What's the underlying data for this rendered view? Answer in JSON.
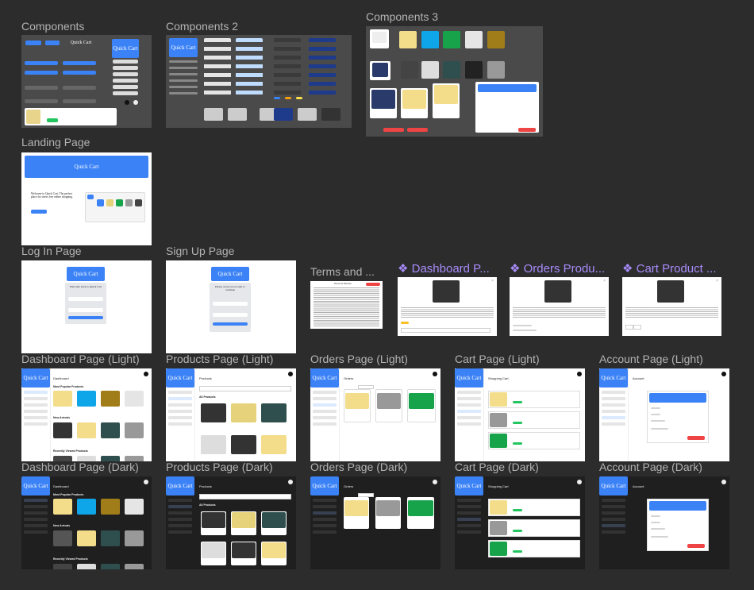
{
  "labels": {
    "components": "Components",
    "components2": "Components 2",
    "components3": "Components 3",
    "landing": "Landing Page",
    "login": "Log In Page",
    "signup": "Sign Up Page",
    "terms": "Terms and ...",
    "dash_popup": "❖ Dashboard P...",
    "orders_popup": "❖ Orders Produ...",
    "cart_popup": "❖ Cart Product ...",
    "dash_light": "Dashboard Page (Light)",
    "products_light": "Products Page (Light)",
    "orders_light": "Orders Page (Light)",
    "cart_light": "Cart Page (Light)",
    "account_light": "Account Page (Light)",
    "dash_dark": "Dashboard Page (Dark)",
    "products_dark": "Products Page (Dark)",
    "orders_dark": "Orders Page (Dark)",
    "cart_dark": "Cart Page (Dark)",
    "account_dark": "Account Page (Dark)"
  },
  "brand": "Quick Cart",
  "frames": {
    "landing_tagline": "Welcome to Quick Cart. The perfect place for stress free online shopping.",
    "login_heading": "Welcome back to Quick Cart",
    "signup_heading": "Please create an account to continue",
    "dash_title": "Dashboard",
    "dash_most_popular": "Most Popular Products",
    "dash_new_arrivals": "New Arrivals",
    "dash_recently_viewed": "Recently Viewed Products",
    "products_title": "Products",
    "products_all": "All Products",
    "orders_title": "Orders",
    "cart_title": "Shopping Cart",
    "account_title": "Account",
    "terms_title": "Terms & Service"
  },
  "colors": {
    "canvas": "#2c2c2c",
    "brand_blue": "#3b82f6",
    "frame_dark": "#1f1f1f",
    "danger": "#ef4444",
    "success": "#22c55e",
    "component_label": "#a78bfa"
  }
}
